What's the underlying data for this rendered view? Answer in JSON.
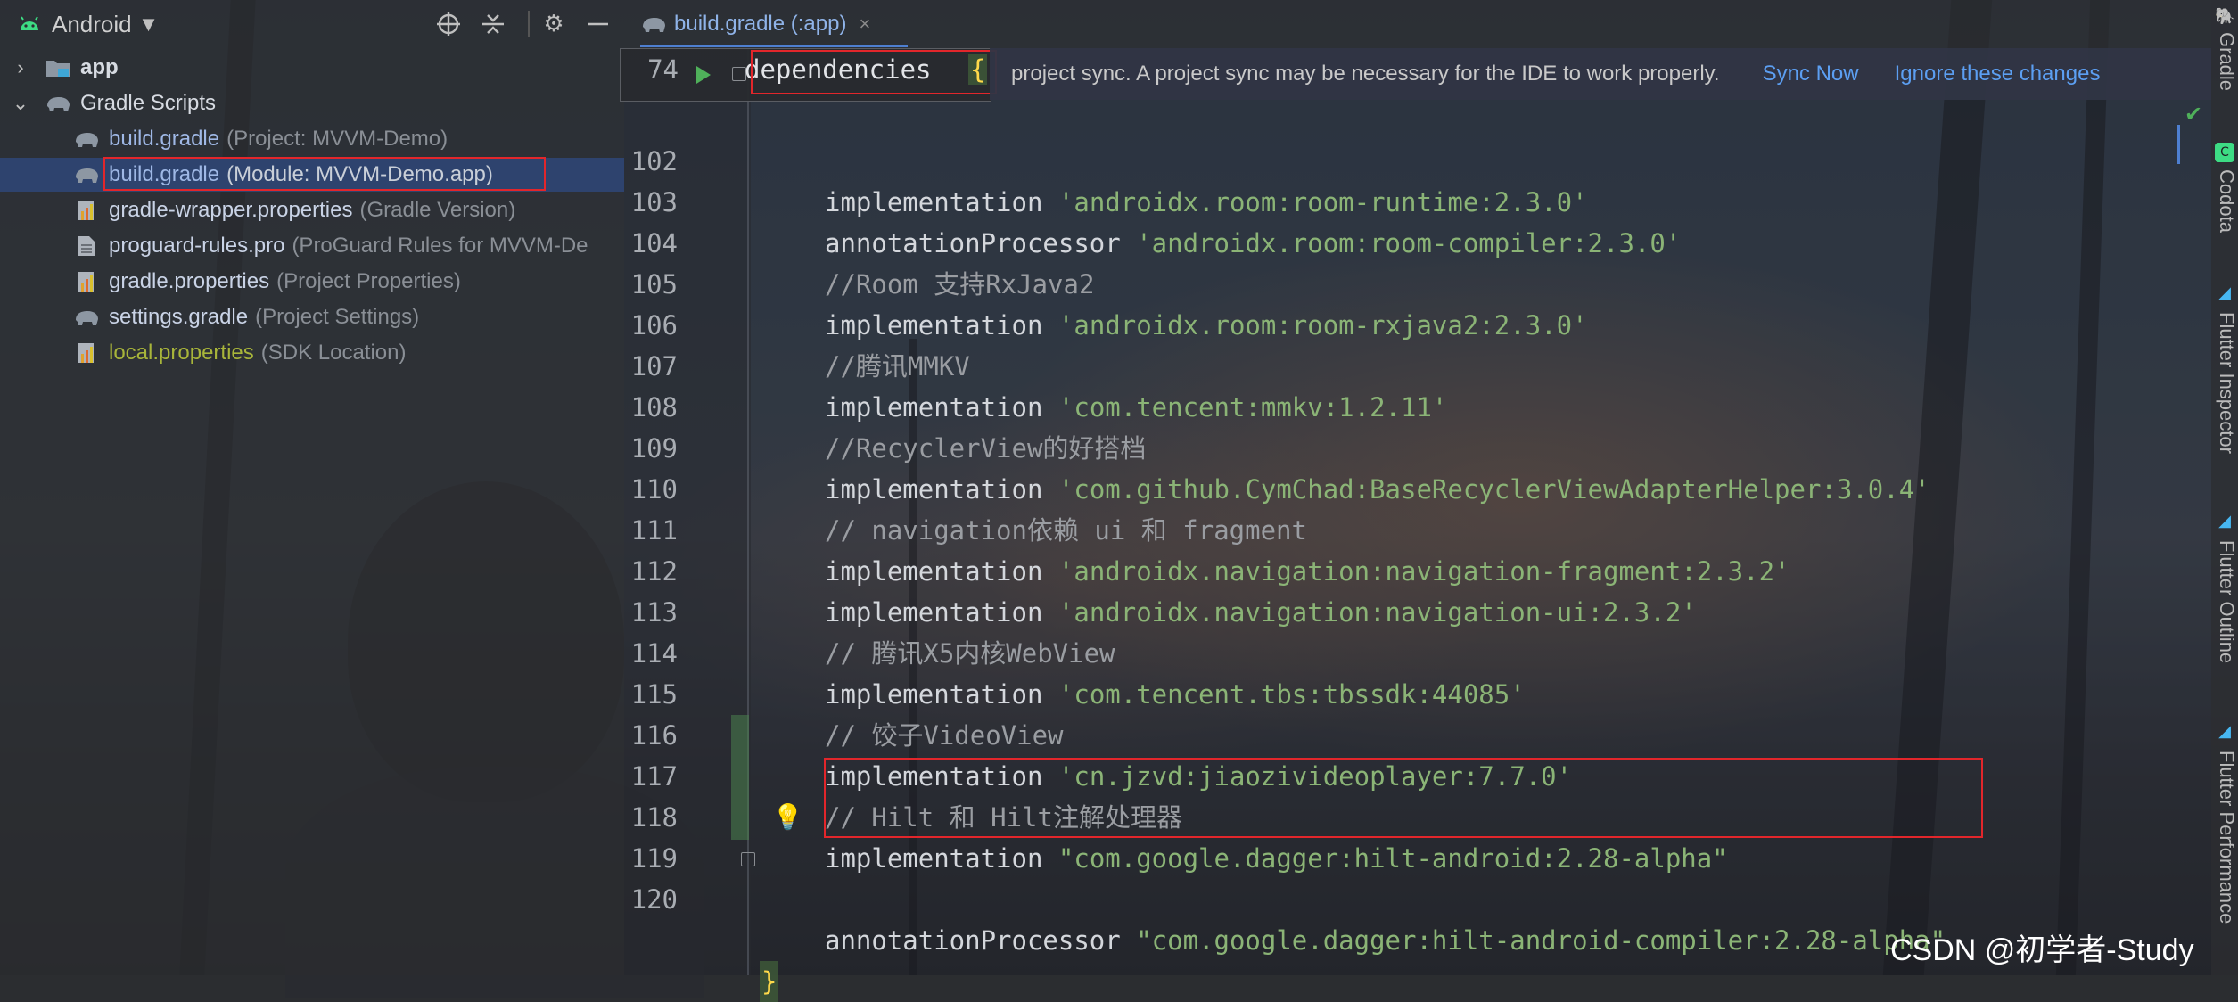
{
  "project_panel": {
    "view_name": "Android",
    "tree": [
      {
        "name": "app",
        "hint": ""
      },
      {
        "name": "Gradle Scripts",
        "hint": ""
      },
      {
        "name": "build.gradle",
        "hint": "(Project: MVVM-Demo)"
      },
      {
        "name": "build.gradle",
        "hint": "(Module: MVVM-Demo.app)"
      },
      {
        "name": "gradle-wrapper.properties",
        "hint": "(Gradle Version)"
      },
      {
        "name": "proguard-rules.pro",
        "hint": "(ProGuard Rules for MVVM-De"
      },
      {
        "name": "gradle.properties",
        "hint": "(Project Properties)"
      },
      {
        "name": "settings.gradle",
        "hint": "(Project Settings)"
      },
      {
        "name": "local.properties",
        "hint": "(SDK Location)"
      }
    ]
  },
  "editor_tab": {
    "label": "build.gradle (:app)",
    "close": "×"
  },
  "notification": {
    "message": "project sync. A project sync may be necessary for the IDE to work properly.",
    "sync_now": "Sync Now",
    "ignore": "Ignore these changes"
  },
  "sticky_header": {
    "line_number": "74",
    "keyword": "dependencies",
    "brace": "{"
  },
  "code_lines": [
    {
      "num": "102",
      "kw": "implementation",
      "str": "'androidx.room:room-runtime:2.3.0'",
      "cmt": ""
    },
    {
      "num": "103",
      "kw": "annotationProcessor",
      "str": "'androidx.room:room-compiler:2.3.0'",
      "cmt": ""
    },
    {
      "num": "104",
      "kw": "",
      "str": "",
      "cmt": "//Room 支持RxJava2"
    },
    {
      "num": "105",
      "kw": "implementation",
      "str": "'androidx.room:room-rxjava2:2.3.0'",
      "cmt": ""
    },
    {
      "num": "106",
      "kw": "",
      "str": "",
      "cmt": "//腾讯MMKV"
    },
    {
      "num": "107",
      "kw": "implementation",
      "str": "'com.tencent:mmkv:1.2.11'",
      "cmt": ""
    },
    {
      "num": "108",
      "kw": "",
      "str": "",
      "cmt": "//RecyclerView的好搭档"
    },
    {
      "num": "109",
      "kw": "implementation",
      "str": "'com.github.CymChad:BaseRecyclerViewAdapterHelper:3.0.4'",
      "cmt": ""
    },
    {
      "num": "110",
      "kw": "",
      "str": "",
      "cmt": "// navigation依赖 ui 和 fragment"
    },
    {
      "num": "111",
      "kw": "implementation",
      "str": "'androidx.navigation:navigation-fragment:2.3.2'",
      "cmt": ""
    },
    {
      "num": "112",
      "kw": "implementation",
      "str": "'androidx.navigation:navigation-ui:2.3.2'",
      "cmt": ""
    },
    {
      "num": "113",
      "kw": "",
      "str": "",
      "cmt": "// 腾讯X5内核WebView"
    },
    {
      "num": "114",
      "kw": "implementation",
      "str": "'com.tencent.tbs:tbssdk:44085'",
      "cmt": ""
    },
    {
      "num": "115",
      "kw": "",
      "str": "",
      "cmt": "// 饺子VideoView"
    },
    {
      "num": "116",
      "kw": "implementation",
      "str": "'cn.jzvd:jiaozivideoplayer:7.7.0'",
      "cmt": ""
    },
    {
      "num": "117",
      "kw": "",
      "str": "",
      "cmt": "// Hilt 和 Hilt注解处理器"
    },
    {
      "num": "118",
      "kw": "implementation",
      "str": "\"com.google.dagger:hilt-android:2.28-alpha\"",
      "cmt": ""
    },
    {
      "num": "119",
      "kw": "annotationProcessor",
      "str": "\"com.google.dagger:hilt-android-compiler:2.28-alpha\"",
      "cmt": ""
    },
    {
      "num": "120",
      "kw": "",
      "str": "",
      "cmt": "",
      "brace": "}"
    }
  ],
  "tool_windows": [
    "Gradle",
    "Codota",
    "Flutter Inspector",
    "Flutter Outline",
    "Flutter Performance"
  ],
  "watermark": "CSDN @初学者-Study",
  "colors": {
    "selection": "#2e436e",
    "link": "#5c9ff2",
    "string": "#8bb476",
    "highlight_box": "#e2262b",
    "brace": "#ffd94a"
  }
}
